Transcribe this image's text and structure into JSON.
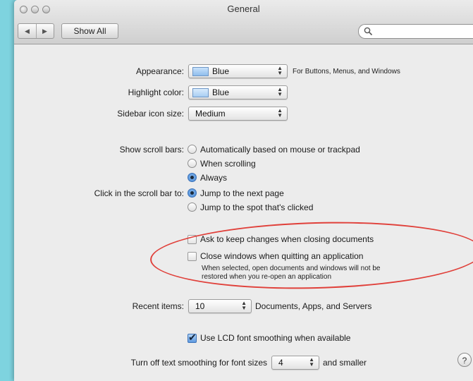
{
  "window": {
    "title": "General"
  },
  "toolbar": {
    "back_glyph": "◀",
    "forward_glyph": "▶",
    "show_all_label": "Show All",
    "search_placeholder": ""
  },
  "appearance": {
    "label": "Appearance:",
    "value": "Blue",
    "note": "For Buttons, Menus, and Windows"
  },
  "highlight": {
    "label": "Highlight color:",
    "value": "Blue"
  },
  "sidebar_icon": {
    "label": "Sidebar icon size:",
    "value": "Medium"
  },
  "scroll_bars": {
    "label": "Show scroll bars:",
    "options": [
      {
        "label": "Automatically based on mouse or trackpad",
        "selected": false
      },
      {
        "label": "When scrolling",
        "selected": false
      },
      {
        "label": "Always",
        "selected": true
      }
    ]
  },
  "click_scroll": {
    "label": "Click in the scroll bar to:",
    "options": [
      {
        "label": "Jump to the next page",
        "selected": true
      },
      {
        "label": "Jump to the spot that's clicked",
        "selected": false
      }
    ]
  },
  "documents": {
    "ask_keep_changes": {
      "label": "Ask to keep changes when closing documents",
      "checked": false
    },
    "close_windows": {
      "label": "Close windows when quitting an application",
      "checked": false
    },
    "note_line1": "When selected, open documents and windows will not be",
    "note_line2": "restored when you re-open an application"
  },
  "recent_items": {
    "label": "Recent items:",
    "value": "10",
    "suffix": "Documents, Apps, and Servers"
  },
  "lcd_smoothing": {
    "label": "Use LCD font smoothing when available",
    "checked": true
  },
  "text_smoothing": {
    "prefix": "Turn off text smoothing for font sizes",
    "value": "4",
    "suffix": "and smaller"
  },
  "help": {
    "glyph": "?"
  },
  "colors": {
    "desktop": "#7ed3df",
    "window": "#ececec",
    "annotation": "#e0403a",
    "selected_control": "#3f7fcf"
  }
}
